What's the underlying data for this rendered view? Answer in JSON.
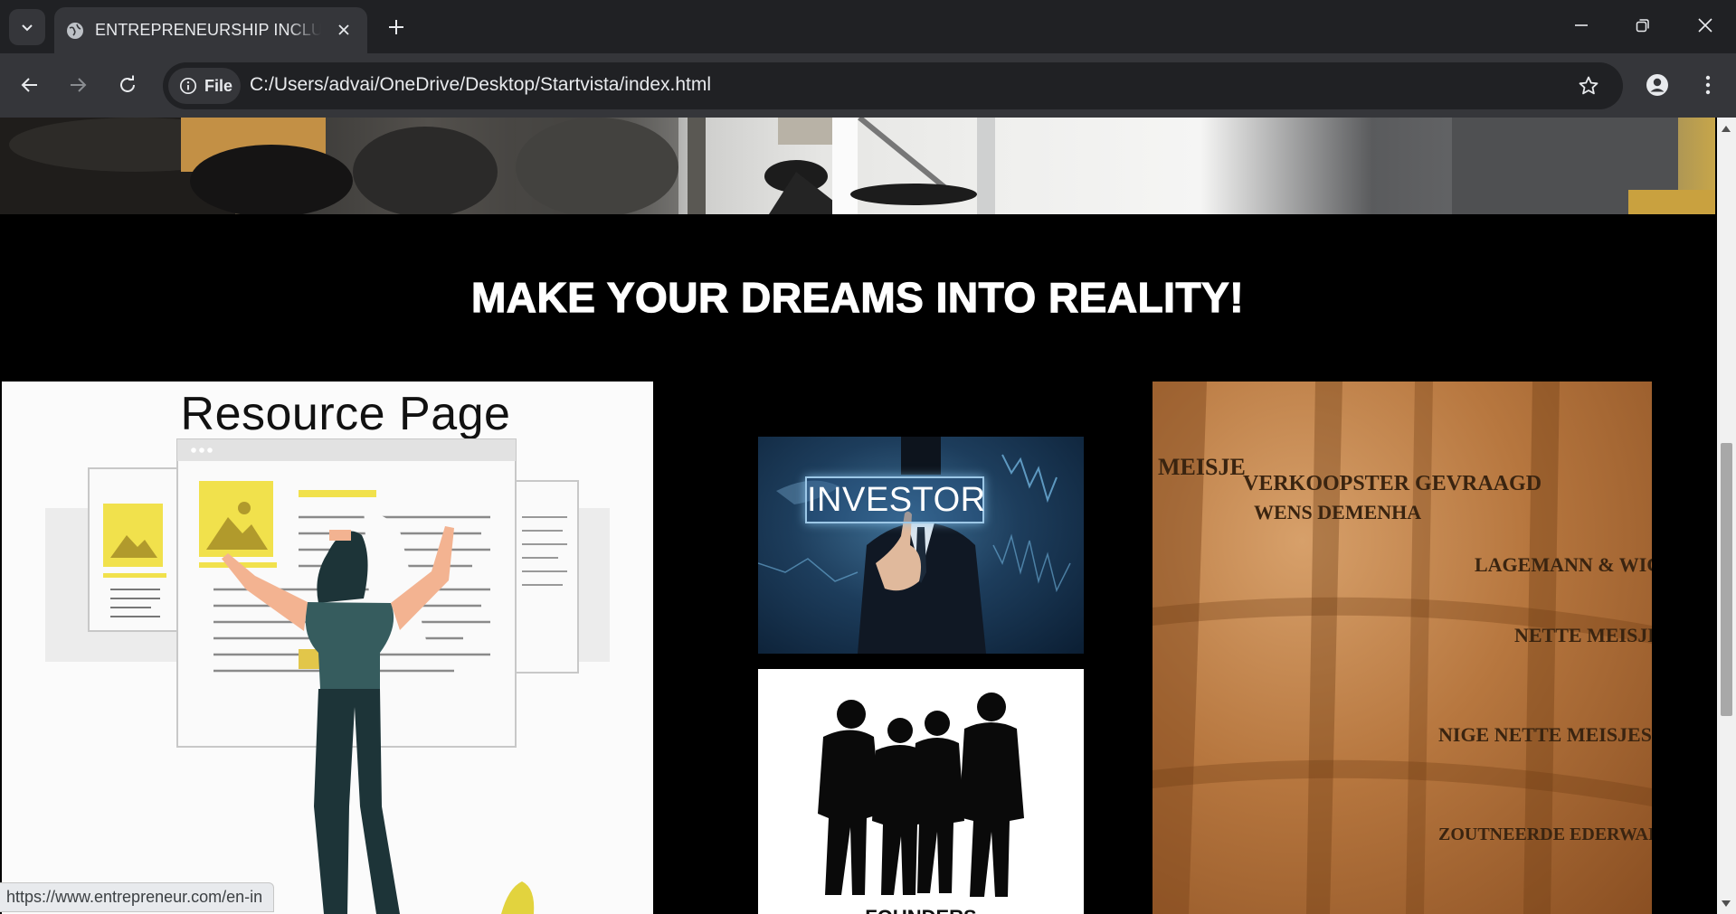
{
  "browser": {
    "tab_title": "ENTREPRENEURSHIP INCLUBLA",
    "omnibox_chip": "File",
    "url": "C:/Users/advai/OneDrive/Desktop/Startvista/index.html",
    "status_url": "https://www.entrepreneur.com/en-in"
  },
  "page": {
    "headline": "MAKE YOUR DREAMS INTO REALITY!",
    "resource_card_title": "Resource Page",
    "investor_label": "INVESTOR",
    "founders_label": "FOUNDERS"
  },
  "newspaper_text": [
    "MEISJE",
    "VERKOOPSTER GEVRAAGD",
    "WENS DEMENHA",
    "LAGEMANN & WIGGERMA",
    "NETTE MEISJES",
    "NIGE NETTE MEISJES",
    "ZOUTNEERDE EDERWAREN"
  ],
  "colors": {
    "chrome_dark": "#202124",
    "chrome_toolbar": "#35363a",
    "chrome_text": "#e8eaed",
    "page_bg": "#000000",
    "headline": "#ffffff",
    "accent_yellow": "#f1e14c",
    "figure_teal": "#365c5e"
  }
}
